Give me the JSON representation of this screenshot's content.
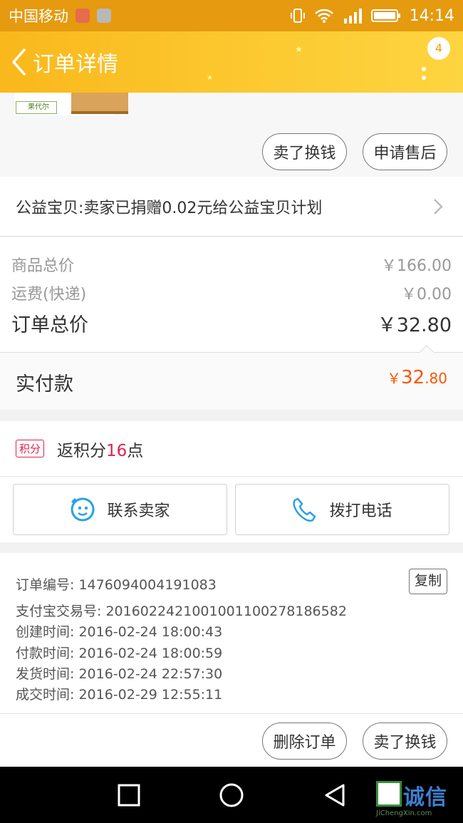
{
  "status_bar": {
    "carrier": "中国移动",
    "time": "14:14"
  },
  "header": {
    "title": "订单详情",
    "badge_count": "4"
  },
  "product": {
    "shop_logo_text": "果代尔",
    "actions": {
      "sell_exchange": "卖了换钱",
      "after_sale": "申请售后"
    }
  },
  "charity": {
    "text": "公益宝贝:卖家已捐赠0.02元给公益宝贝计划"
  },
  "price_summary": {
    "goods_total_label": "商品总价",
    "goods_total_value": "￥166.00",
    "shipping_label": "运费(快递)",
    "shipping_value": "￥0.00",
    "order_total_label": "订单总价",
    "order_total_value": "￥32.80"
  },
  "payment": {
    "label": "实付款",
    "currency": "￥",
    "amount_int": "32",
    "amount_cents": ".80"
  },
  "points": {
    "tag": "积分",
    "prefix": "返积分",
    "value": "16",
    "suffix": "点"
  },
  "contact": {
    "seller_label": "联系卖家",
    "call_label": "拨打电话"
  },
  "order_details": {
    "order_no": "订单编号: 1476094004191083",
    "copy_label": "复制",
    "alipay_no": "支付宝交易号: 2016022421001001100278186582",
    "created": "创建时间: 2016-02-24 18:00:43",
    "paid": "付款时间: 2016-02-24 18:00:59",
    "shipped": "发货时间: 2016-02-24 22:57:30",
    "completed": "成交时间: 2016-02-29 12:55:11"
  },
  "bottom_actions": {
    "delete_order": "删除订单",
    "sell_exchange": "卖了换钱"
  },
  "watermark": {
    "brand": "诚信",
    "url": "JiChengXin.com"
  },
  "colors": {
    "accent_orange": "#ff5500",
    "header_yellow": "#fcc930",
    "points_red": "#e0224e",
    "link_blue": "#2aa0e8"
  }
}
